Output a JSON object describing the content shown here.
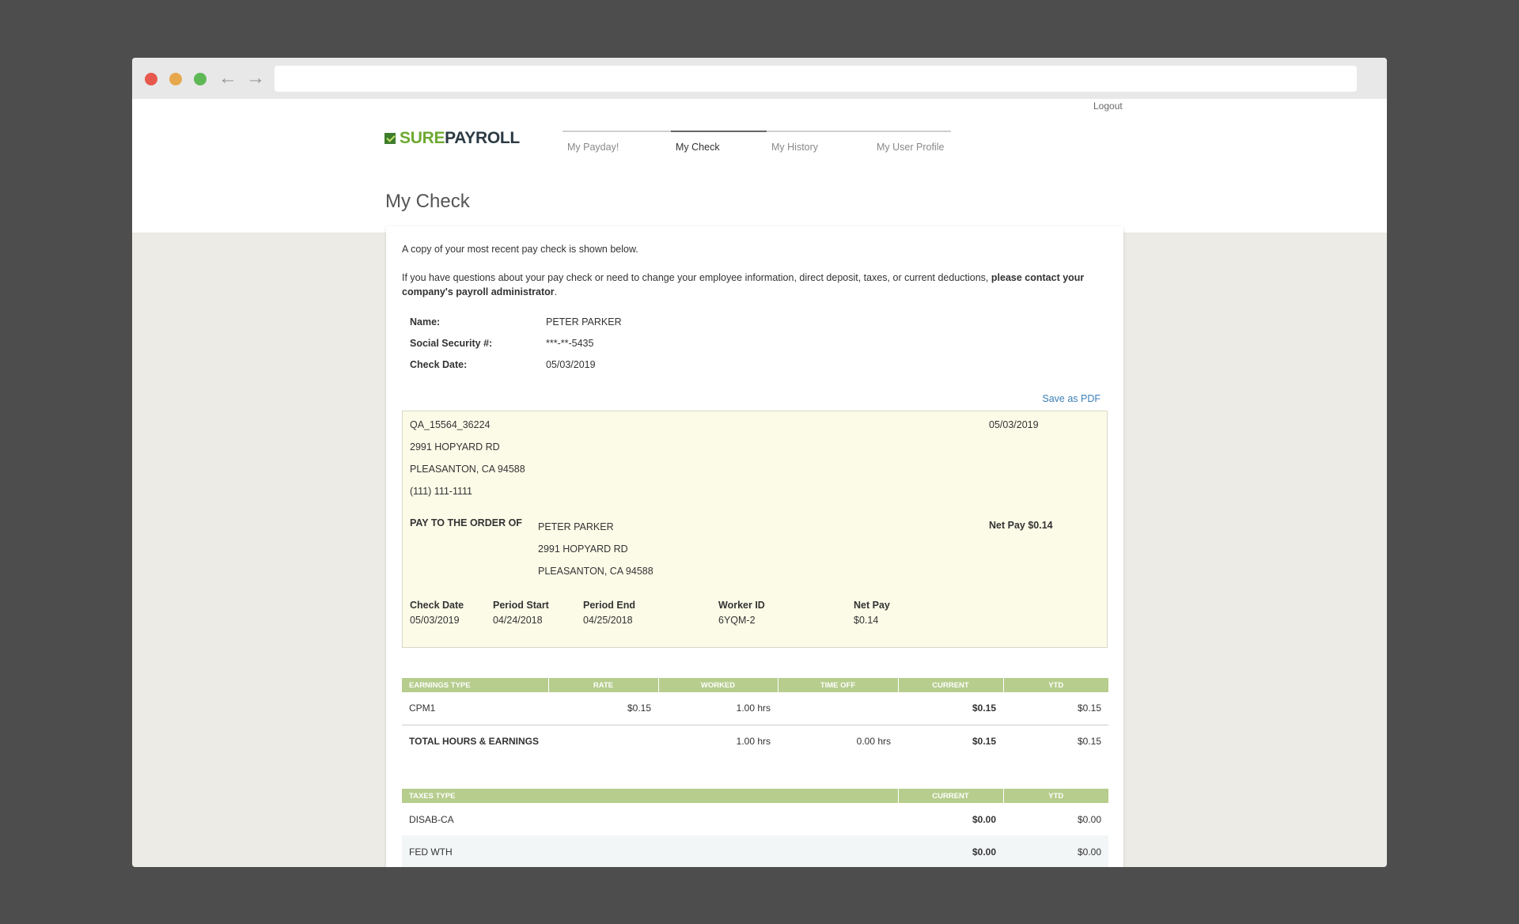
{
  "header": {
    "logout": "Logout",
    "logo_sure": "SURE",
    "logo_payroll": "PAYROLL",
    "tabs": [
      {
        "label": "My Payday!",
        "active": false
      },
      {
        "label": "My Check",
        "active": true
      },
      {
        "label": "My History",
        "active": false
      },
      {
        "label": "My User Profile",
        "active": false
      }
    ]
  },
  "page": {
    "title": "My Check",
    "intro1": "A copy of your most recent pay check is shown below.",
    "intro2_plain": "If you have questions about your pay check or need to change your employee information, direct deposit, taxes, or current deductions, ",
    "intro2_bold": "please contact your company's payroll administrator",
    "intro2_end": "."
  },
  "employee": {
    "name_label": "Name:",
    "name": "PETER PARKER",
    "ssn_label": "Social Security #:",
    "ssn": "***-**-5435",
    "date_label": "Check Date:",
    "date": "05/03/2019"
  },
  "save_pdf": "Save as PDF",
  "check": {
    "company_id": "QA_15564_36224",
    "company_street": "2991 HOPYARD RD",
    "company_city": "PLEASANTON, CA 94588",
    "company_phone": "(111) 111-1111",
    "date": "05/03/2019",
    "pay_to_label": "PAY TO THE ORDER OF",
    "payee_name": "PETER PARKER",
    "payee_street": "2991 HOPYARD RD",
    "payee_city": "PLEASANTON, CA 94588",
    "net_pay_line": "Net Pay $0.14",
    "col_check_date": "Check Date",
    "val_check_date": "05/03/2019",
    "col_period_start": "Period Start",
    "val_period_start": "04/24/2018",
    "col_period_end": "Period End",
    "val_period_end": "04/25/2018",
    "col_worker_id": "Worker ID",
    "val_worker_id": "6YQM-2",
    "col_net_pay": "Net Pay",
    "val_net_pay": "$0.14"
  },
  "earnings": {
    "headers": [
      "EARNINGS TYPE",
      "RATE",
      "WORKED",
      "TIME OFF",
      "CURRENT",
      "YTD"
    ],
    "row": {
      "type": "CPM1",
      "rate": "$0.15",
      "worked": "1.00 hrs",
      "time_off": "",
      "current": "$0.15",
      "ytd": "$0.15"
    },
    "total": {
      "label": "TOTAL HOURS & EARNINGS",
      "worked": "1.00 hrs",
      "time_off": "0.00 hrs",
      "current": "$0.15",
      "ytd": "$0.15"
    }
  },
  "taxes": {
    "headers": [
      "TAXES TYPE",
      "CURRENT",
      "YTD"
    ],
    "rows": [
      {
        "type": "DISAB-CA",
        "current": "$0.00",
        "ytd": "$0.00"
      },
      {
        "type": "FED WTH",
        "current": "$0.00",
        "ytd": "$0.00"
      }
    ]
  }
}
